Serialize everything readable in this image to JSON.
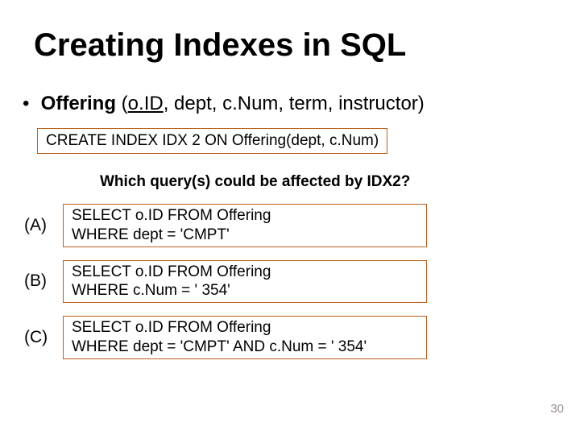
{
  "title": "Creating  Indexes  in  SQL",
  "schema": {
    "bullet": "•",
    "label": "Offering",
    "open": "  (",
    "pk": "o.ID",
    "rest": ", dept, c.Num, term, instructor)"
  },
  "create_stmt": "CREATE INDEX IDX 2 ON Offering(dept, c.Num)",
  "question": "Which  query(s)  could  be  affected  by  IDX2?",
  "options": {
    "a": {
      "label": "(A)",
      "line1": "SELECT o.ID FROM Offering",
      "line2": "WHERE  dept = 'CMPT'"
    },
    "b": {
      "label": "(B)",
      "line1": "SELECT o.ID FROM Offering",
      "line2": "WHERE  c.Num = ' 354'"
    },
    "c": {
      "label": "(C)",
      "line1": "SELECT o.ID FROM Offering",
      "line2": "WHERE  dept = 'CMPT' AND c.Num = ' 354'"
    }
  },
  "page_number": "30"
}
